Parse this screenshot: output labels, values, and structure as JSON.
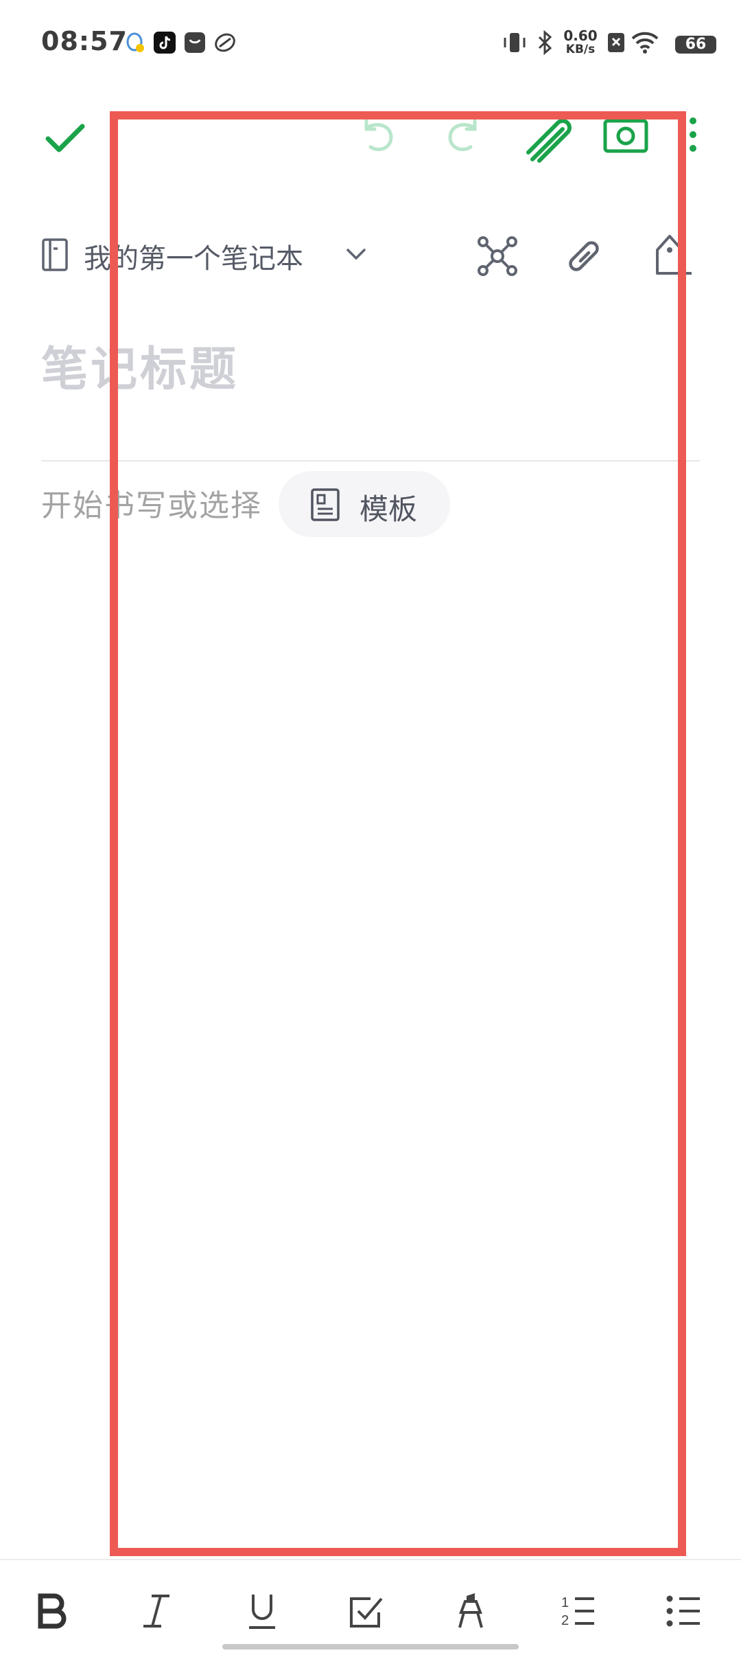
{
  "status_bar": {
    "time": "08:57",
    "net_speed_value": "0.60",
    "net_speed_unit": "KB/s",
    "battery": "66"
  },
  "toolbar": {
    "icons": [
      "check-icon",
      "undo-icon",
      "redo-icon",
      "attachment-icon",
      "camera-icon",
      "more-icon"
    ]
  },
  "notebook": {
    "name": "我的第一个笔记本"
  },
  "note": {
    "title_placeholder": "笔记标题",
    "body_placeholder": "开始书写或选择",
    "template_label": "模板"
  },
  "format_bar": {
    "icons": [
      "bold-icon",
      "italic-icon",
      "underline-icon",
      "checkbox-icon",
      "highlighter-icon",
      "numbered-list-icon",
      "bullet-list-icon"
    ]
  },
  "colors": {
    "accent": "#1aa34a",
    "accent_light": "#b8e6cb",
    "highlight_border": "#ed5a53",
    "icon_gray": "#5f6470"
  }
}
